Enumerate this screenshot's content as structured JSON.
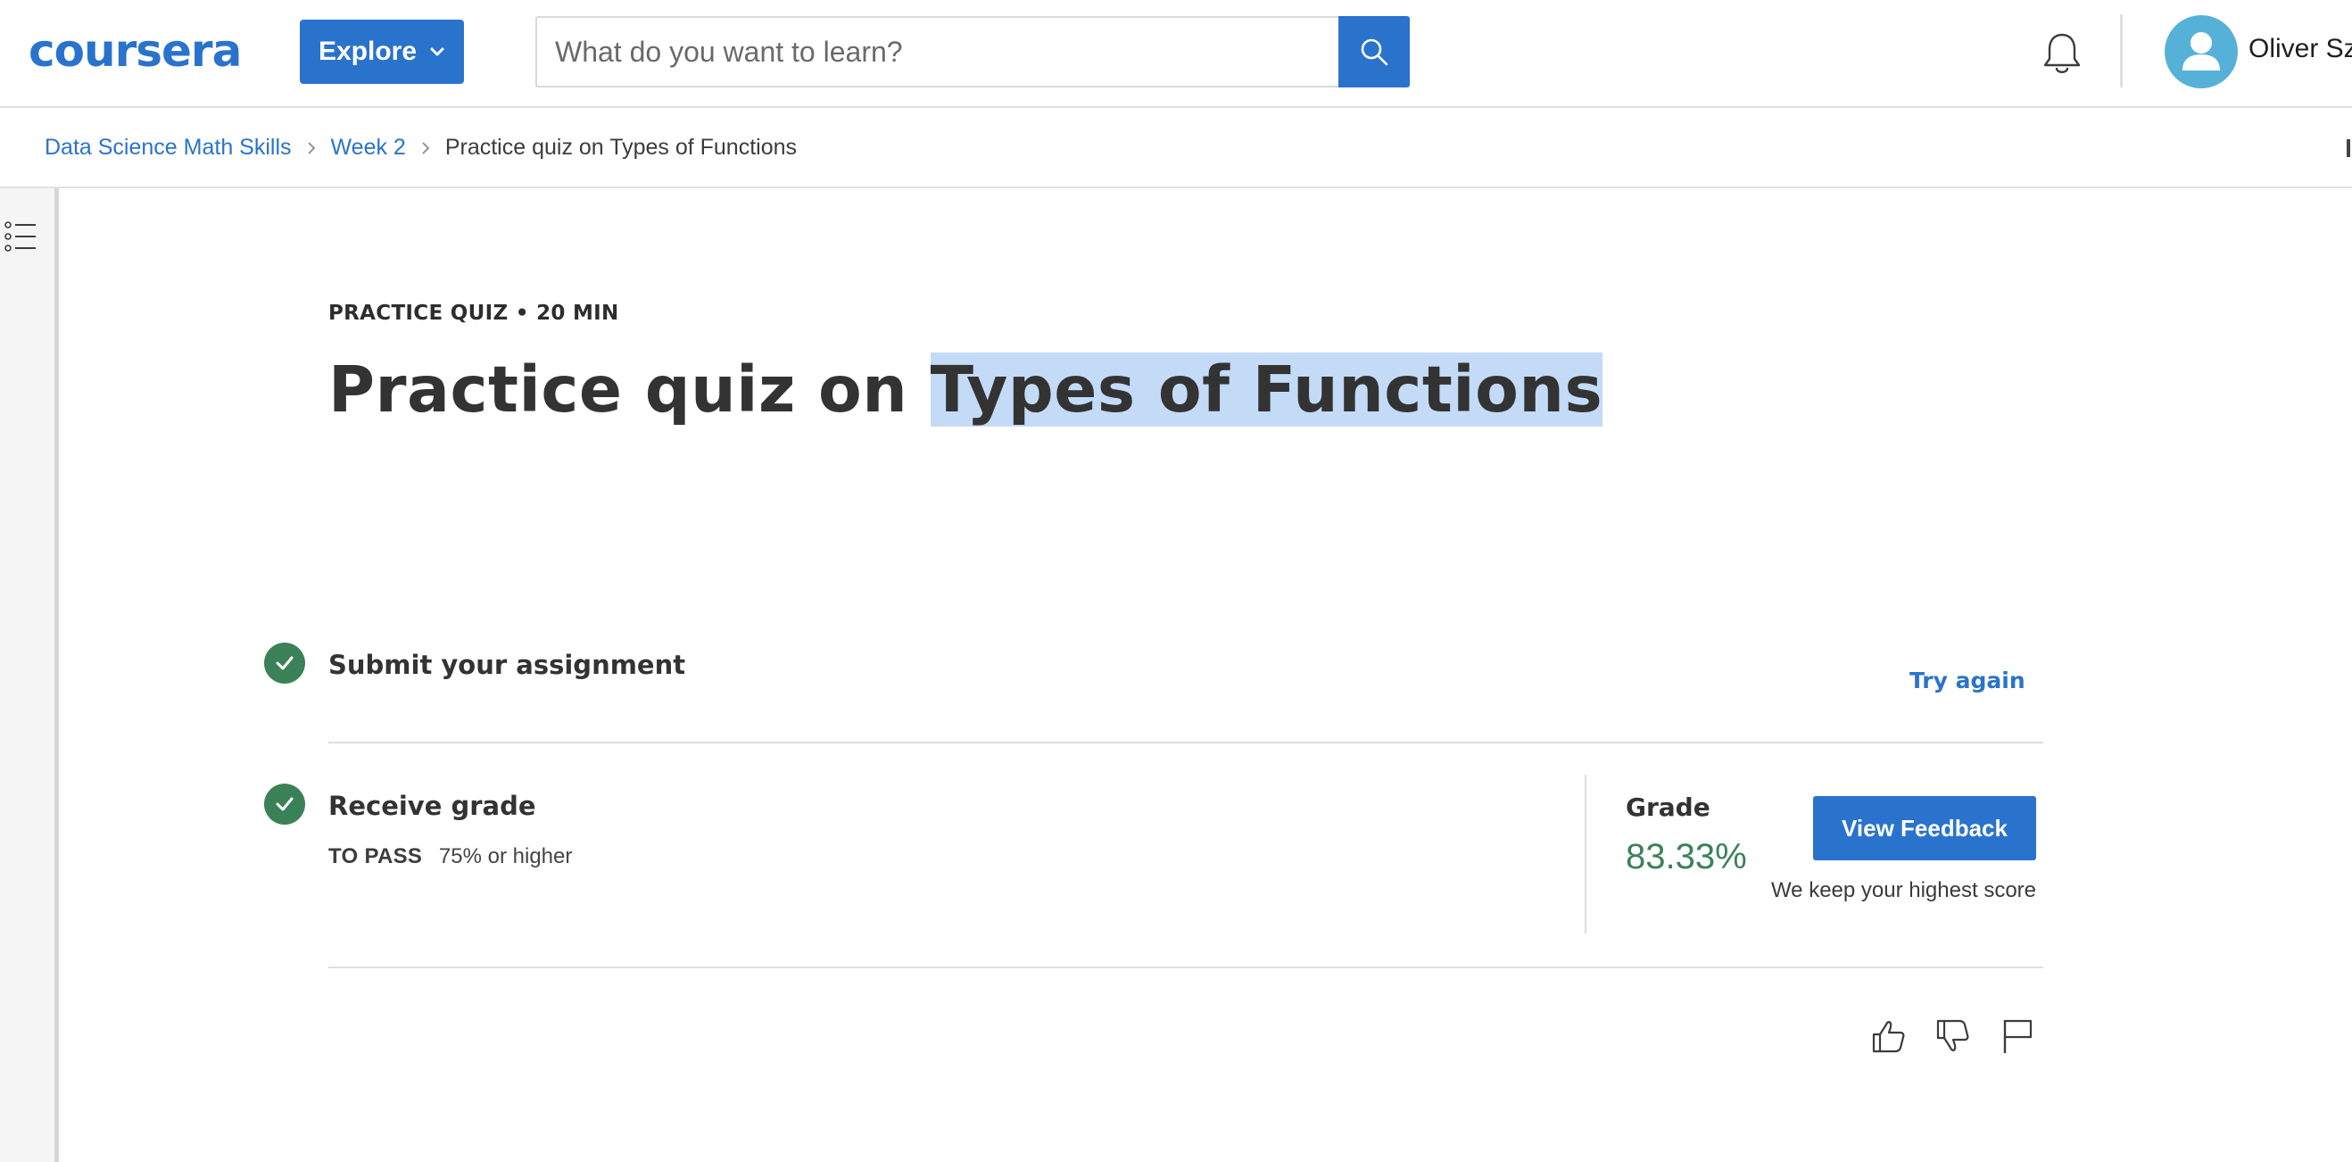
{
  "header": {
    "logo_text": "coursera",
    "explore_label": "Explore",
    "search_placeholder": "What do you want to learn?",
    "user_name": "Oliver Sz"
  },
  "breadcrumb": {
    "items": [
      {
        "label": "Data Science Math Skills"
      },
      {
        "label": "Week 2"
      }
    ],
    "current": "Practice quiz on Types of Functions"
  },
  "quiz": {
    "eyebrow": "PRACTICE QUIZ • 20 MIN",
    "title_plain": "Practice quiz on ",
    "title_highlighted": "Types of Functions",
    "submit_step": {
      "title": "Submit your assignment",
      "try_again_label": "Try again"
    },
    "grade_step": {
      "title": "Receive grade",
      "to_pass_label": "TO PASS",
      "to_pass_value": "75% or higher",
      "grade_label": "Grade",
      "grade_value": "83.33%",
      "view_feedback_label": "View Feedback",
      "keep_note": "We keep your highest score"
    }
  },
  "colors": {
    "brand_blue": "#2a73cc",
    "success_green": "#3b8158",
    "highlight": "#c3dbf7"
  },
  "icons": [
    "outline-toggle-icon",
    "chevron-down-icon",
    "search-icon",
    "bell-icon",
    "avatar-person-icon",
    "chevron-right-icon",
    "check-icon",
    "thumbs-up-icon",
    "thumbs-down-icon",
    "flag-icon"
  ]
}
